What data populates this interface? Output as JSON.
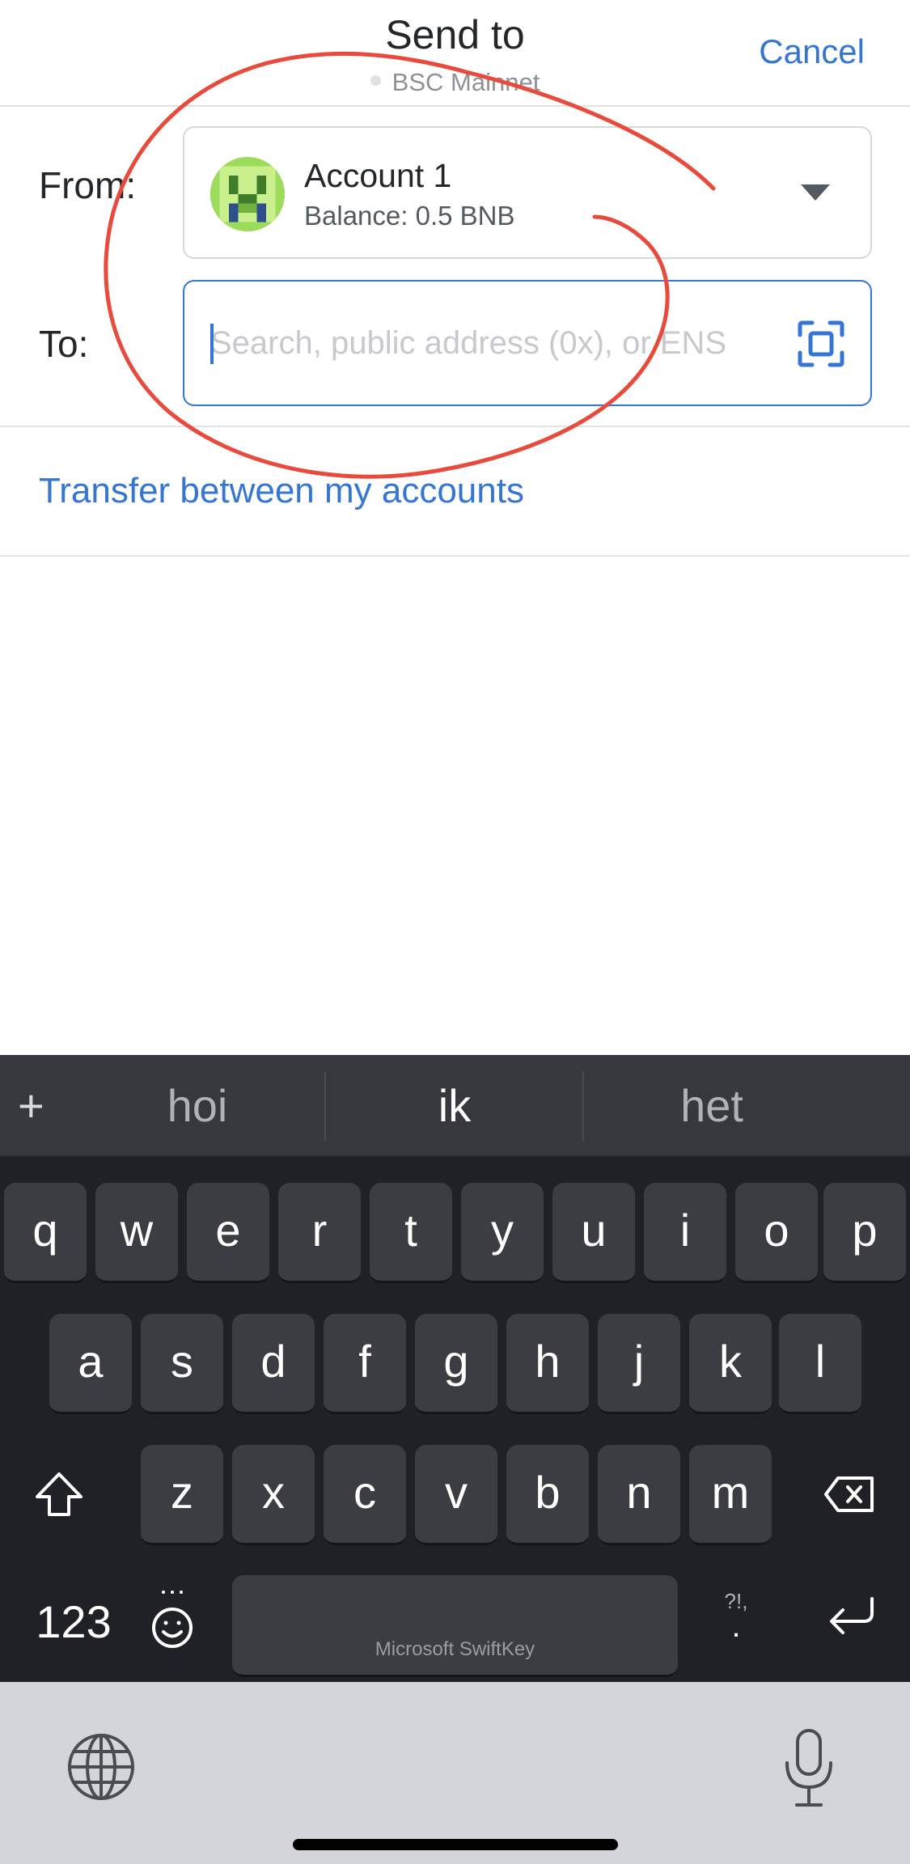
{
  "header": {
    "title": "Send to",
    "network": "BSC Mainnet",
    "cancel_label": "Cancel"
  },
  "form": {
    "from_label": "From:",
    "to_label": "To:",
    "account": {
      "name": "Account 1",
      "balance": "Balance: 0.5 BNB"
    },
    "to_placeholder": "Search, public address (0x), or ENS",
    "to_value": ""
  },
  "transfer_link": "Transfer between my accounts",
  "keyboard": {
    "suggestion_plus": "+",
    "suggestions": [
      "hoi",
      "ik",
      "het"
    ],
    "row1": [
      "q",
      "w",
      "e",
      "r",
      "t",
      "y",
      "u",
      "i",
      "o",
      "p"
    ],
    "row2": [
      "a",
      "s",
      "d",
      "f",
      "g",
      "h",
      "j",
      "k",
      "l"
    ],
    "row3": [
      "z",
      "x",
      "c",
      "v",
      "b",
      "n",
      "m"
    ],
    "numbers_label": "123",
    "punct_top": "?!,",
    "punct_bottom": ".",
    "space_label": "Microsoft SwiftKey"
  },
  "icons": {
    "caret": "chevron-down-icon",
    "scan": "qr-scan-icon",
    "shift": "shift-icon",
    "backspace": "backspace-icon",
    "emoji": "emoji-icon",
    "enter": "return-icon",
    "globe": "globe-icon",
    "mic": "microphone-icon"
  },
  "colors": {
    "accent": "#3476d2",
    "annotation": "#e84a3c",
    "keyboard_bg": "#1f2126",
    "key_bg": "#3b3d42"
  }
}
